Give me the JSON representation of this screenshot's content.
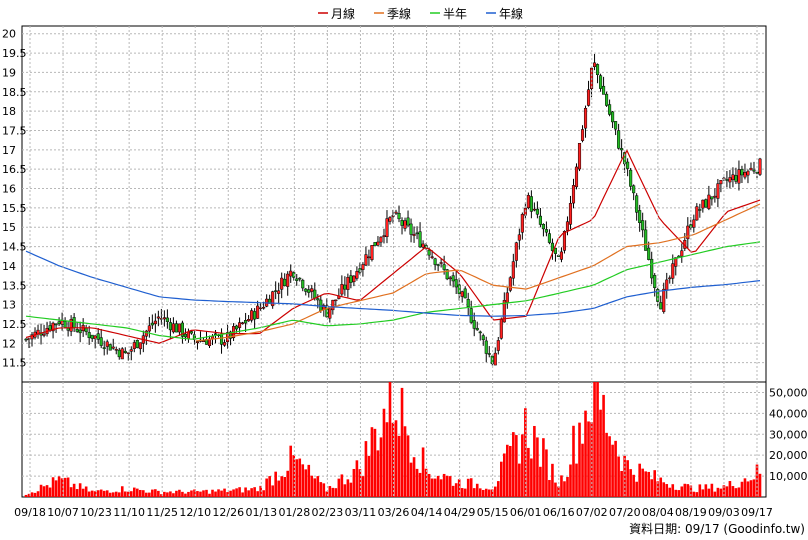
{
  "footer_note": "資料日期: 09/17  (Goodinfo.tw)",
  "chart_data": [
    {
      "type": "candlestick",
      "legend": [
        {
          "name": "月線",
          "color": "#cc0000"
        },
        {
          "name": "季線",
          "color": "#e07020"
        },
        {
          "name": "半年",
          "color": "#22cc22"
        },
        {
          "name": "年線",
          "color": "#1f5fd0"
        }
      ],
      "legend_placement": "top-center",
      "grid": true,
      "ylim": [
        11,
        20.2
      ],
      "y_ticks": [
        "11.5",
        "12",
        "12.5",
        "13",
        "13.5",
        "14",
        "14.5",
        "15",
        "15.5",
        "16",
        "16.5",
        "17",
        "17.5",
        "18",
        "18.5",
        "19",
        "19.5",
        "20"
      ],
      "x_tick_labels": [
        "09/18",
        "10/07",
        "10/23",
        "11/10",
        "11/25",
        "12/10",
        "12/26",
        "01/13",
        "01/28",
        "02/23",
        "03/11",
        "03/26",
        "04/14",
        "04/29",
        "05/15",
        "06/01",
        "06/16",
        "07/02",
        "07/20",
        "08/04",
        "08/19",
        "09/03",
        "09/17"
      ],
      "price_anchors": [
        {
          "x": "09/18",
          "close": 12.1
        },
        {
          "x": "10/07",
          "close": 12.6
        },
        {
          "x": "10/23",
          "close": 12.2
        },
        {
          "x": "11/10",
          "close": 11.7
        },
        {
          "x": "11/25",
          "close": 12.7
        },
        {
          "x": "12/10",
          "close": 12.1
        },
        {
          "x": "12/26",
          "close": 12.1
        },
        {
          "x": "01/13",
          "close": 12.9
        },
        {
          "x": "01/28",
          "close": 13.9
        },
        {
          "x": "02/23",
          "close": 12.8
        },
        {
          "x": "03/11",
          "close": 14.0
        },
        {
          "x": "03/26",
          "close": 15.3
        },
        {
          "x": "04/14",
          "close": 14.5
        },
        {
          "x": "04/29",
          "close": 13.3
        },
        {
          "x": "05/15",
          "close": 11.5
        },
        {
          "x": "06/01",
          "close": 15.8
        },
        {
          "x": "06/16",
          "close": 14.0
        },
        {
          "x": "07/02",
          "close": 19.3
        },
        {
          "x": "07/20",
          "close": 16.5
        },
        {
          "x": "08/04",
          "close": 13.0
        },
        {
          "x": "08/19",
          "close": 15.3
        },
        {
          "x": "09/03",
          "close": 16.2
        },
        {
          "x": "09/17",
          "close": 16.6
        }
      ],
      "ma_series": [
        {
          "name": "月線",
          "values": [
            12.15,
            12.4,
            12.4,
            12.2,
            12.0,
            12.35,
            12.25,
            12.25,
            12.9,
            13.3,
            13.1,
            13.8,
            14.5,
            13.8,
            12.6,
            12.7,
            14.8,
            15.2,
            17.0,
            15.2,
            14.3,
            15.4,
            15.7
          ]
        },
        {
          "name": "季線",
          "values": [
            null,
            null,
            null,
            null,
            null,
            12.05,
            12.15,
            12.3,
            12.5,
            12.9,
            13.1,
            13.3,
            13.8,
            13.9,
            13.5,
            13.4,
            13.7,
            14.0,
            14.5,
            14.6,
            14.8,
            15.2,
            15.6
          ]
        },
        {
          "name": "半年",
          "values": [
            12.7,
            12.6,
            12.5,
            12.4,
            12.2,
            12.1,
            12.25,
            12.4,
            12.6,
            12.45,
            12.5,
            12.6,
            12.8,
            12.9,
            13.0,
            13.1,
            13.3,
            13.5,
            13.9,
            14.1,
            14.3,
            14.5,
            14.62
          ]
        },
        {
          "name": "年線",
          "values": [
            14.38,
            14.0,
            13.7,
            13.45,
            13.2,
            13.12,
            13.08,
            13.05,
            13.02,
            12.95,
            12.9,
            12.85,
            12.78,
            12.72,
            12.7,
            12.72,
            12.78,
            12.9,
            13.2,
            13.35,
            13.45,
            13.52,
            13.62
          ]
        }
      ]
    },
    {
      "type": "bar",
      "series": [
        {
          "name": "",
          "color": "#ff0000"
        }
      ],
      "ylim": [
        0,
        55000
      ],
      "y_ticks": [
        "10,000",
        "20,000",
        "30,000",
        "40,000",
        "50,000"
      ],
      "y_tick_values": [
        10000,
        20000,
        30000,
        40000,
        50000
      ],
      "volume_anchors": [
        {
          "x": "09/18",
          "value": 1500
        },
        {
          "x": "10/07",
          "value": 8000
        },
        {
          "x": "10/23",
          "value": 2500
        },
        {
          "x": "11/10",
          "value": 4000
        },
        {
          "x": "11/25",
          "value": 2500
        },
        {
          "x": "12/10",
          "value": 2500
        },
        {
          "x": "12/26",
          "value": 3000
        },
        {
          "x": "01/13",
          "value": 4000
        },
        {
          "x": "01/28",
          "value": 18000
        },
        {
          "x": "02/23",
          "value": 3500
        },
        {
          "x": "03/11",
          "value": 14000
        },
        {
          "x": "03/26",
          "value": 49000
        },
        {
          "x": "04/14",
          "value": 13000
        },
        {
          "x": "04/29",
          "value": 7000
        },
        {
          "x": "05/15",
          "value": 5000
        },
        {
          "x": "06/01",
          "value": 34000
        },
        {
          "x": "06/16",
          "value": 6000
        },
        {
          "x": "07/02",
          "value": 52000
        },
        {
          "x": "07/20",
          "value": 15000
        },
        {
          "x": "08/04",
          "value": 8000
        },
        {
          "x": "08/19",
          "value": 4000
        },
        {
          "x": "09/03",
          "value": 5000
        },
        {
          "x": "09/17",
          "value": 12000
        }
      ]
    }
  ]
}
